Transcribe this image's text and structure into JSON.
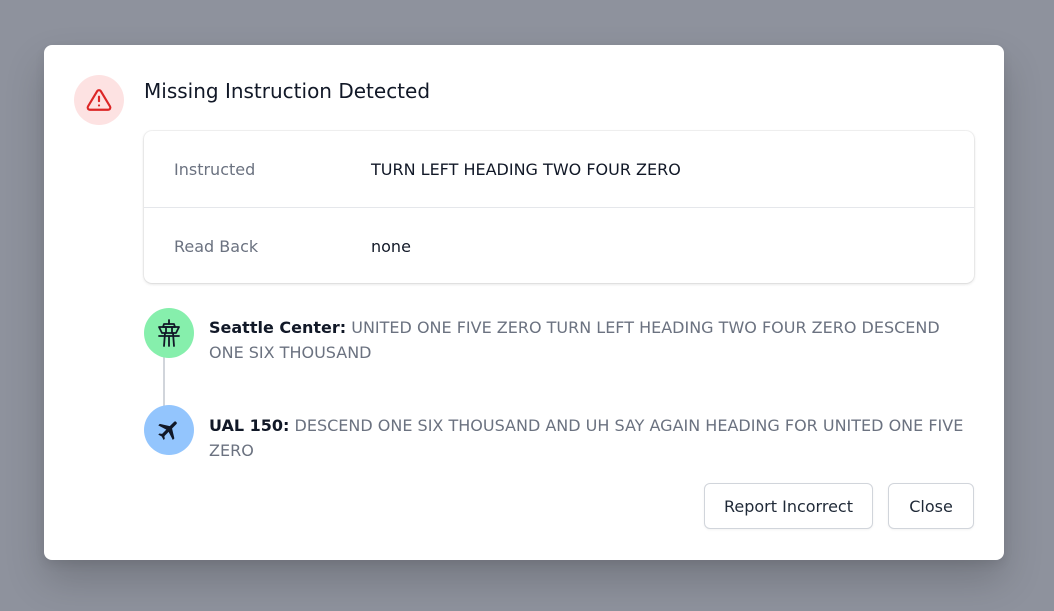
{
  "dialog": {
    "title": "Missing Instruction Detected",
    "alert_icon": "warning-triangle-icon",
    "alert_color": "#dc2626",
    "alert_bg": "#fde2e2"
  },
  "details": {
    "instructed_label": "Instructed",
    "instructed_value": "TURN LEFT HEADING TWO FOUR ZERO",
    "readback_label": "Read Back",
    "readback_value": "none"
  },
  "transcript": [
    {
      "icon": "control-tower-icon",
      "icon_bg": "#86efac",
      "speaker": "Seattle Center:",
      "message": "UNITED ONE FIVE ZERO TURN LEFT HEADING TWO FOUR ZERO DESCEND ONE SIX THOUSAND"
    },
    {
      "icon": "airplane-icon",
      "icon_bg": "#93c5fd",
      "speaker": "UAL 150:",
      "message": "DESCEND ONE SIX THOUSAND AND UH SAY AGAIN HEADING FOR UNITED ONE FIVE ZERO"
    }
  ],
  "actions": {
    "report_label": "Report Incorrect",
    "close_label": "Close"
  }
}
